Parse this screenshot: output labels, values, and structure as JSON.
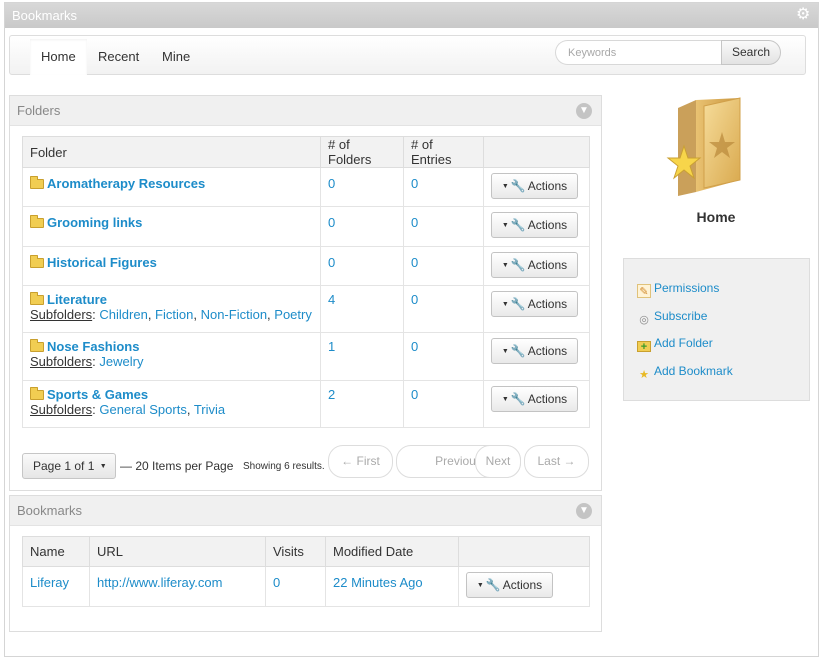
{
  "portlet": {
    "title": "Bookmarks",
    "gear_icon": "gear-icon"
  },
  "nav": {
    "tabs": [
      "Home",
      "Recent",
      "Mine"
    ],
    "search_placeholder": "Keywords",
    "search_label": "Search"
  },
  "folders_panel": {
    "title": "Folders",
    "columns": [
      "Folder",
      "# of Folders",
      "# of Entries",
      ""
    ],
    "subfolders_label": "Subfolders",
    "actions_label": "Actions",
    "rows": [
      {
        "name": "Aromatherapy Resources",
        "folders": "0",
        "entries": "0",
        "subfolders": []
      },
      {
        "name": "Grooming links",
        "folders": "0",
        "entries": "0",
        "subfolders": []
      },
      {
        "name": "Historical Figures",
        "folders": "0",
        "entries": "0",
        "subfolders": []
      },
      {
        "name": "Literature",
        "folders": "4",
        "entries": "0",
        "subfolders": [
          "Children",
          "Fiction",
          "Non-Fiction",
          "Poetry"
        ]
      },
      {
        "name": "Nose Fashions",
        "folders": "1",
        "entries": "0",
        "subfolders": [
          "Jewelry"
        ]
      },
      {
        "name": "Sports & Games",
        "folders": "2",
        "entries": "0",
        "subfolders": [
          "General Sports",
          "Trivia"
        ]
      }
    ],
    "pagination": {
      "page_label": "Page 1 of 1",
      "per_page": "— 20 Items per Page",
      "showing": "Showing 6 results.",
      "first": "← First",
      "previous": "Previous",
      "next": "Next",
      "last": "Last →"
    }
  },
  "bookmarks_panel": {
    "title": "Bookmarks",
    "columns": [
      "Name",
      "URL",
      "Visits",
      "Modified Date",
      ""
    ],
    "actions_label": "Actions",
    "rows": [
      {
        "name": "Liferay",
        "url": "http://www.liferay.com",
        "visits": "0",
        "modified": "22 Minutes Ago"
      }
    ]
  },
  "sidebar": {
    "folder_title": "Home",
    "items": [
      {
        "label": "Permissions",
        "icon": "permissions-icon"
      },
      {
        "label": "Subscribe",
        "icon": "subscribe-icon"
      },
      {
        "label": "Add Folder",
        "icon": "add-folder-icon"
      },
      {
        "label": "Add Bookmark",
        "icon": "add-bookmark-icon"
      }
    ]
  }
}
